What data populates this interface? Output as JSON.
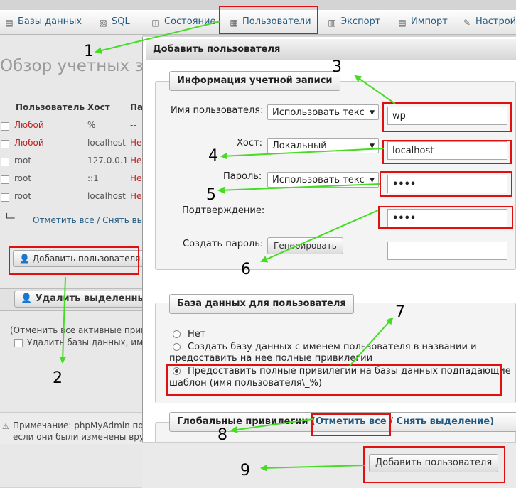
{
  "topbar": {
    "tabs": [
      {
        "label": "Базы данных",
        "icon": "database-icon"
      },
      {
        "label": "SQL",
        "icon": "sql-icon"
      },
      {
        "label": "Состояние",
        "icon": "status-icon"
      },
      {
        "label": "Пользователи",
        "icon": "users-icon"
      },
      {
        "label": "Экспорт",
        "icon": "export-icon"
      },
      {
        "label": "Импорт",
        "icon": "import-icon"
      },
      {
        "label": "Настрой",
        "icon": "wrench-icon"
      }
    ]
  },
  "background": {
    "title": "Обзор учетных за",
    "headers": {
      "user": "Пользователь",
      "host": "Хост",
      "pass": "Па"
    },
    "rows": [
      {
        "user": "Любой",
        "host": "%",
        "pass": "--"
      },
      {
        "user": "Любой",
        "host": "localhost",
        "pass": "Не"
      },
      {
        "user": "root",
        "host": "127.0.0.1",
        "pass": "Не"
      },
      {
        "user": "root",
        "host": "::1",
        "pass": "Не"
      },
      {
        "user": "root",
        "host": "localhost",
        "pass": "Не"
      }
    ],
    "check_all": "Отметить все / Снять выд",
    "add_user": "Добавить пользователя",
    "delete_selected": "Удалить выделенных",
    "revoke_note": "(Отменить все активные приви",
    "delete_db_label": "Удалить базы данных, име",
    "note_line1": "Примечание: phpMyAdmin пол",
    "note_line2": "если они были изменены вру"
  },
  "dialog": {
    "title": "Добавить пользователя",
    "account_legend": "Информация учетной записи",
    "username_label": "Имя пользователя:",
    "username_mode": "Использовать текс",
    "username_value": "wp",
    "host_label": "Хост:",
    "host_mode": "Локальный",
    "host_value": "localhost",
    "password_label": "Пароль:",
    "password_mode": "Использовать текс",
    "password_value": "••••",
    "confirm_label": "Подтверждение:",
    "confirm_value": "••••",
    "generate_label": "Создать пароль:",
    "generate_button": "Генерировать",
    "db_legend": "База данных для пользователя",
    "opt_none": "Нет",
    "opt_create_1": "Создать базу данных с именем пользователя в названии и",
    "opt_create_2": "предоставить на нее полные привилегии",
    "opt_grant_1": "Предоставить полные привилегии на базы данных подпадающие п",
    "opt_grant_2": "шаблон (имя пользователя\\_%)",
    "global_legend": "Глобальные привилегии",
    "global_check": "(Отметить все",
    "global_uncheck": "/ Снять выделение)",
    "submit": "Добавить пользователя"
  },
  "annotations": [
    "1",
    "2",
    "3",
    "4",
    "5",
    "6",
    "7",
    "8",
    "9"
  ],
  "colors": {
    "annotation_box": "#e01010",
    "arrow": "#44dd22",
    "link": "#235a81"
  }
}
